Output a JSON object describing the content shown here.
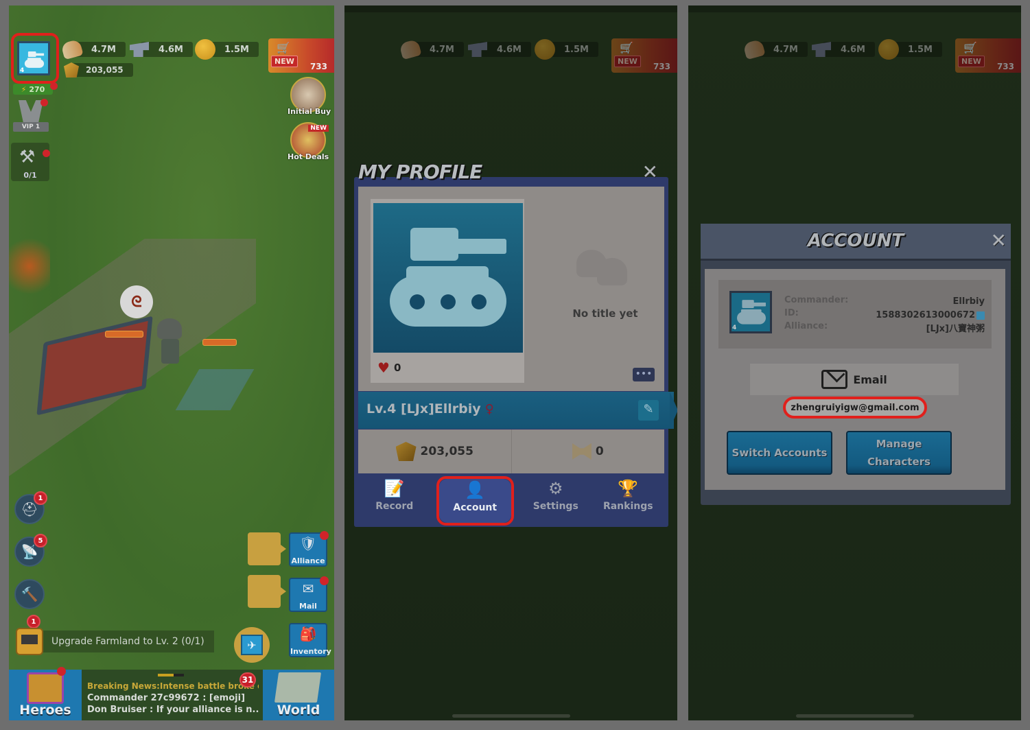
{
  "hud": {
    "resources": [
      {
        "name": "food",
        "icon": "bread-icon",
        "value": "4.7M"
      },
      {
        "name": "iron",
        "icon": "iron-ingot-icon",
        "value": "4.6M"
      },
      {
        "name": "gold",
        "icon": "gold-coin-icon",
        "value": "1.5M"
      }
    ],
    "power": "203,055",
    "shop": {
      "new_label": "NEW",
      "count": "733"
    },
    "avatar_level": "4",
    "stamina": "270",
    "vip": "VIP 1",
    "builder": "0/1",
    "promos": [
      {
        "label": "Initial Buy"
      },
      {
        "label": "Hot Deals",
        "tag": "NEW"
      }
    ]
  },
  "panel1": {
    "side_badges": [
      "1",
      "5"
    ],
    "quest": {
      "badge": "1",
      "text": "Upgrade Farmland to Lv. 2 (0/1)"
    },
    "side_buttons": [
      {
        "label": "Alliance"
      },
      {
        "label": "Mail"
      },
      {
        "label": "Inventory"
      }
    ],
    "bottom": {
      "heroes_label": "Heroes",
      "world_label": "World",
      "chat_badge": "31",
      "ticker": [
        "Breaking News:Intense battle broke out...",
        "Commander 27c99672 : [emoji]",
        "Don Bruiser : If your alliance is n..."
      ]
    }
  },
  "profile": {
    "title": "MY PROFILE",
    "likes": "0",
    "no_title": "No title yet",
    "more_label": "•••",
    "name": "Lv.4 [LJx]Ellrbiy",
    "power": "203,055",
    "kills": "0",
    "tabs": [
      {
        "label": "Record",
        "icon": "record-icon"
      },
      {
        "label": "Account",
        "icon": "account-icon",
        "active": true
      },
      {
        "label": "Settings",
        "icon": "gear-icon"
      },
      {
        "label": "Rankings",
        "icon": "trophy-icon"
      }
    ]
  },
  "account": {
    "title": "ACCOUNT",
    "labels": {
      "commander": "Commander:",
      "id": "ID:",
      "alliance": "Alliance:"
    },
    "values": {
      "commander": "Ellrbiy",
      "id": "1588302613000672",
      "alliance": "[LJx]八寶神粥"
    },
    "avatar_level": "4",
    "email_label": "Email",
    "email_value": "zhengruiyigw@gmail.com",
    "switch_label": "Switch Accounts",
    "manage_label_1": "Manage",
    "manage_label_2": "Characters"
  },
  "colors": {
    "highlight_ring": "#e0201c",
    "button_blue": "#1a6a92",
    "dialog_navy": "#2e3a6a"
  }
}
